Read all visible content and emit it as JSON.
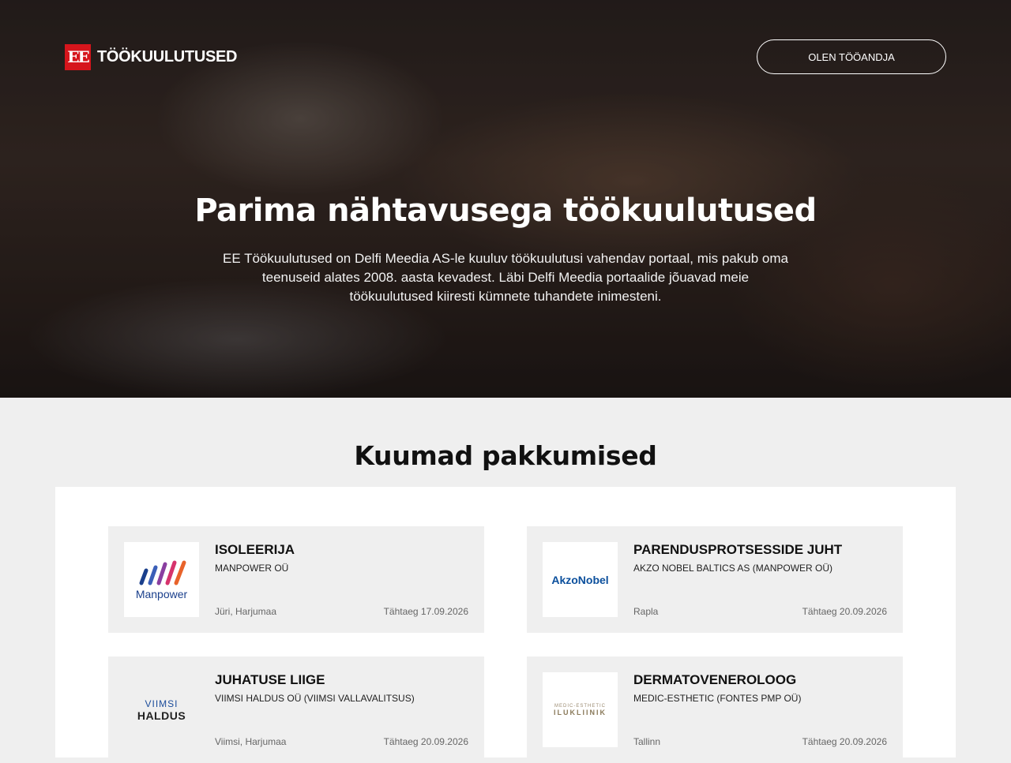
{
  "header": {
    "logo_mark": "EE",
    "logo_text": "TÖÖKUULUTUSED",
    "employer_button": "OLEN TÖÖANDJA"
  },
  "hero": {
    "title": "Parima nähtavusega töökuulutused",
    "description": "EE Töökuulutused on Delfi Meedia AS-le kuuluv töökuulutusi vahendav portaal, mis pakub oma teenuseid alates 2008. aasta kevadest. Läbi Delfi Meedia portaalide jõuavad meie töökuulutused kiiresti kümnete tuhandete inimesteni."
  },
  "offers": {
    "title": "Kuumad pakkumised",
    "jobs": [
      {
        "title": "ISOLEERIJA",
        "company": "MANPOWER OÜ",
        "location": "Jüri, Harjumaa",
        "deadline": "Tähtaeg 17.09.2026",
        "logo_text": "Manpower"
      },
      {
        "title": "PARENDUSPROTSESSIDE JUHT",
        "company": "AKZO NOBEL BALTICS AS (MANPOWER OÜ)",
        "location": "Rapla",
        "deadline": "Tähtaeg 20.09.2026",
        "logo_text": "AkzoNobel"
      },
      {
        "title": "JUHATUSE LIIGE",
        "company": "VIIMSI HALDUS OÜ (VIIMSI VALLAVALITSUS)",
        "location": "Viimsi, Harjumaa",
        "deadline": "Tähtaeg 20.09.2026",
        "logo_text_top": "VIIMSI",
        "logo_text_bottom": "HALDUS"
      },
      {
        "title": "DERMATOVENEROLOOG",
        "company": "MEDIC-ESTHETIC (FONTES PMP OÜ)",
        "location": "Tallinn",
        "deadline": "Tähtaeg 20.09.2026",
        "logo_text_top": "MEDIC-ESTHETIC",
        "logo_text_bottom": "ILUKLIINIK"
      }
    ]
  },
  "colors": {
    "brand_red": "#d6151c",
    "card_bg": "#efefef"
  }
}
